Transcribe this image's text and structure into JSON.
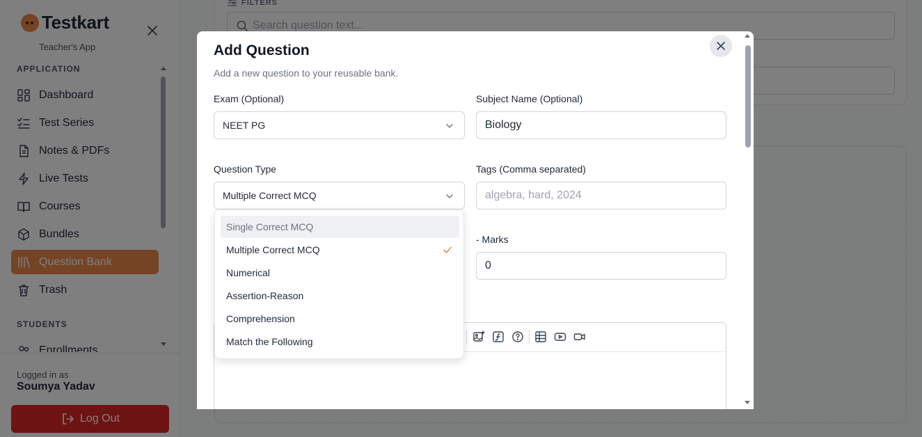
{
  "sidebar": {
    "brand": "Testkart",
    "subtitle": "Teacher's App",
    "section_application": "APPLICATION",
    "section_students": "STUDENTS",
    "items": [
      {
        "label": "Dashboard",
        "icon": "dashboard-icon"
      },
      {
        "label": "Test Series",
        "icon": "checklist-icon"
      },
      {
        "label": "Notes & PDFs",
        "icon": "document-icon"
      },
      {
        "label": "Live Tests",
        "icon": "lightning-icon"
      },
      {
        "label": "Courses",
        "icon": "book-icon"
      },
      {
        "label": "Bundles",
        "icon": "package-icon"
      },
      {
        "label": "Question Bank",
        "icon": "library-icon",
        "active": true
      },
      {
        "label": "Trash",
        "icon": "trash-icon"
      },
      {
        "label": "Enrollments",
        "icon": "users-icon"
      }
    ],
    "logged_in_label": "Logged in as",
    "user_name": "Soumya Yadav",
    "logout_label": "Log Out"
  },
  "background": {
    "filters_label": "FILTERS",
    "search_placeholder": "Search question text..."
  },
  "modal": {
    "title": "Add Question",
    "description": "Add a new question to your reusable bank.",
    "exam": {
      "label": "Exam (Optional)",
      "value": "NEET PG"
    },
    "subject": {
      "label": "Subject Name (Optional)",
      "value": "Biology"
    },
    "question_type": {
      "label": "Question Type",
      "value": "Multiple Correct MCQ"
    },
    "tags": {
      "label": "Tags (Comma separated)",
      "placeholder": "algebra, hard, 2024"
    },
    "negative_marks": {
      "label": "- Marks",
      "value": "0"
    }
  },
  "dropdown": {
    "options": [
      {
        "label": "Single Correct MCQ",
        "hovered": true
      },
      {
        "label": "Multiple Correct MCQ",
        "selected": true
      },
      {
        "label": "Numerical"
      },
      {
        "label": "Assertion-Reason"
      },
      {
        "label": "Comprehension"
      },
      {
        "label": "Match the Following"
      }
    ]
  },
  "colors": {
    "accent": "#e8894a",
    "danger": "#dc2626",
    "check": "#e8894a"
  }
}
